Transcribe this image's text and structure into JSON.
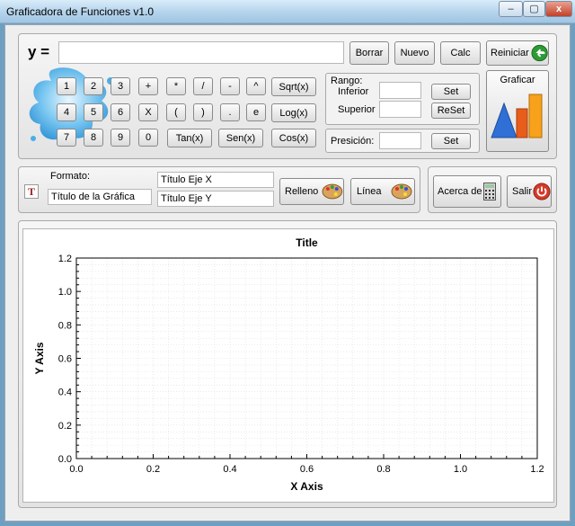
{
  "window": {
    "title": "Graficadora de Funciones v1.0",
    "min": "–",
    "max": "▢",
    "close": "x"
  },
  "function": {
    "label": "y =",
    "value": ""
  },
  "buttons": {
    "borrar": "Borrar",
    "nuevo": "Nuevo",
    "calc": "Calc",
    "reiniciar": "Reiniciar",
    "graficar": "Graficar",
    "set_rango": "Set",
    "reset_rango": "ReSet",
    "set_presicion": "Set",
    "relleno": "Relleno",
    "linea": "Línea",
    "acerca": "Acerca de",
    "salir": "Salir"
  },
  "keypad": {
    "row1": [
      "1",
      "2",
      "3",
      "+",
      "*",
      "/",
      "-",
      "^"
    ],
    "row2": [
      "4",
      "5",
      "6",
      "X",
      "(",
      ")",
      ".",
      "e"
    ],
    "row3": [
      "7",
      "8",
      "9",
      "0"
    ],
    "funcs": {
      "sqrt": "Sqrt(x)",
      "log": "Log(x)",
      "cos": "Cos(x)",
      "tan": "Tan(x)",
      "sen": "Sen(x)"
    }
  },
  "rango": {
    "title": "Rango:",
    "inferior_label": "Inferior",
    "superior_label": "Superior",
    "inferior": "",
    "superior": ""
  },
  "presicion": {
    "label": "Presición:",
    "value": ""
  },
  "formato": {
    "label": "Formato:",
    "titulo_grafica": "Título de la Gráfica",
    "titulo_eje_x": "Título Eje X",
    "titulo_eje_y": "Título Eje Y"
  },
  "chart_data": {
    "type": "line",
    "title": "Title",
    "xlabel": "X Axis",
    "ylabel": "Y Axis",
    "xlim": [
      0,
      1.2
    ],
    "ylim": [
      0,
      1.2
    ],
    "xticks": [
      "0.0",
      "0.2",
      "0.4",
      "0.6",
      "0.8",
      "1.0",
      "1.2"
    ],
    "yticks": [
      "0.0",
      "0.2",
      "0.4",
      "0.6",
      "0.8",
      "1.0",
      "1.2"
    ],
    "grid": true,
    "series": []
  }
}
